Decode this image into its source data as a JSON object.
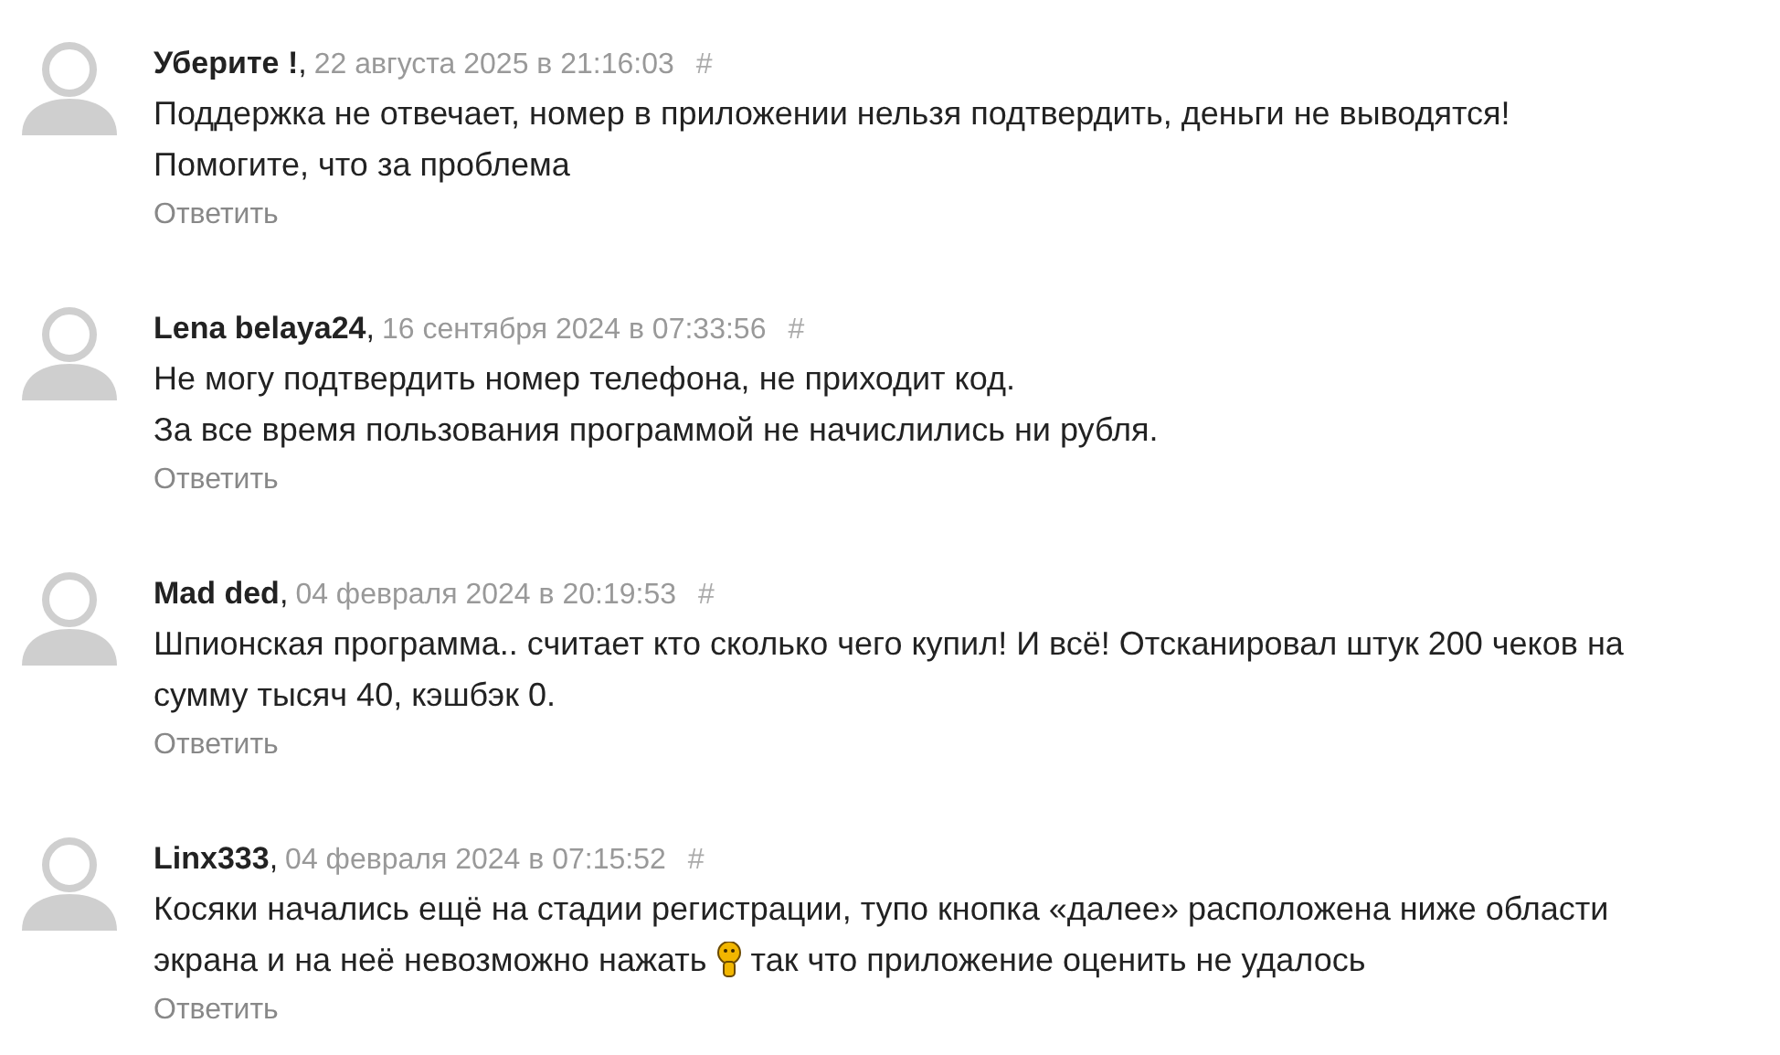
{
  "comments": [
    {
      "author": "Уберите !",
      "separator": ",",
      "date": "22 августа 2025 в 21:16:03",
      "anchor": "#",
      "lines": [
        [
          {
            "kind": "text",
            "text": "Поддержка не отвечает, номер в приложении нельзя подтвердить, деньги не выводятся!"
          }
        ],
        [
          {
            "kind": "text",
            "text": "Помогите, что за проблема"
          }
        ]
      ],
      "reply": "Ответить"
    },
    {
      "author": "Lena belaya24",
      "separator": ",",
      "date": "16 сентября 2024 в 07:33:56",
      "anchor": "#",
      "lines": [
        [
          {
            "kind": "text",
            "text": "Не могу подтвердить номер телефона, не приходит код."
          }
        ],
        [
          {
            "kind": "text",
            "text": "За все время пользования программой не начислились ни рубля."
          }
        ]
      ],
      "reply": "Ответить"
    },
    {
      "author": "Mad ded",
      "separator": ",",
      "date": "04 февраля 2024 в 20:19:53",
      "anchor": "#",
      "lines": [
        [
          {
            "kind": "text",
            "text": "Шпионская программа.. считает кто сколько чего купил! И всё! Отсканировал штук 200 чеков на"
          }
        ],
        [
          {
            "kind": "text",
            "text": "сумму тысяч 40, кэшбэк 0."
          }
        ]
      ],
      "reply": "Ответить"
    },
    {
      "author": "Linx333",
      "separator": ",",
      "date": "04 февраля 2024 в 07:15:52",
      "anchor": "#",
      "lines": [
        [
          {
            "kind": "text",
            "text": "Косяки начались ещё на стадии регистрации, тупо кнопка «далее» расположена ниже области"
          }
        ],
        [
          {
            "kind": "text",
            "text": "экрана и на неё невозможно нажать"
          },
          {
            "kind": "emoji"
          },
          {
            "kind": "text",
            "text": "так что приложение оценить не удалось"
          }
        ]
      ],
      "reply": "Ответить"
    }
  ]
}
